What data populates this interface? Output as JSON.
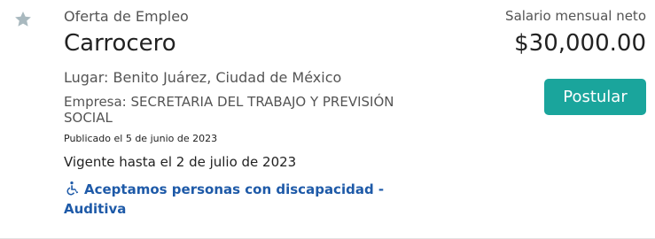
{
  "job": {
    "kicker": "Oferta de Empleo",
    "title": "Carrocero",
    "location": "Lugar: Benito Juárez, Ciudad de México",
    "company": "Empresa: SECRETARIA DEL TRABAJO Y PREVISIÓN SOCIAL",
    "published": "Publicado el 5 de junio de 2023",
    "valid_until": "Vigente hasta el 2 de julio de 2023",
    "accessibility": "Aceptamos personas con discapacidad - Auditiva"
  },
  "salary": {
    "label": "Salario mensual neto",
    "value": "$30,000.00"
  },
  "actions": {
    "apply_label": "Postular"
  },
  "icons": {
    "favorite": "star-icon",
    "accessibility": "wheelchair-icon"
  },
  "colors": {
    "accent_button": "#1aa59c",
    "link_blue": "#1e5aa8",
    "star_gray": "#a9b9bf"
  }
}
